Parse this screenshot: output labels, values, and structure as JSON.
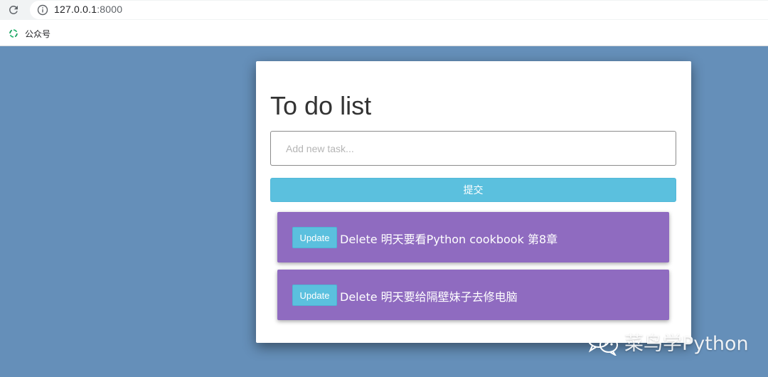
{
  "browser": {
    "url_host": "127.0.0.1",
    "url_port": ":8000",
    "bookmark_label": "公众号"
  },
  "app": {
    "title": "To do list",
    "input_placeholder": "Add new task...",
    "submit_label": "提交",
    "tasks": [
      {
        "update_label": "Update",
        "delete_label": "Delete",
        "text": "明天要看Python cookbook 第8章"
      },
      {
        "update_label": "Update",
        "delete_label": "Delete",
        "text": "明天要给隔壁妹子去修电脑"
      }
    ]
  },
  "watermark": "菜鸟学Python",
  "colors": {
    "background": "#658fb9",
    "task_card": "#8f6bc0",
    "accent_button": "#5bc0de"
  }
}
